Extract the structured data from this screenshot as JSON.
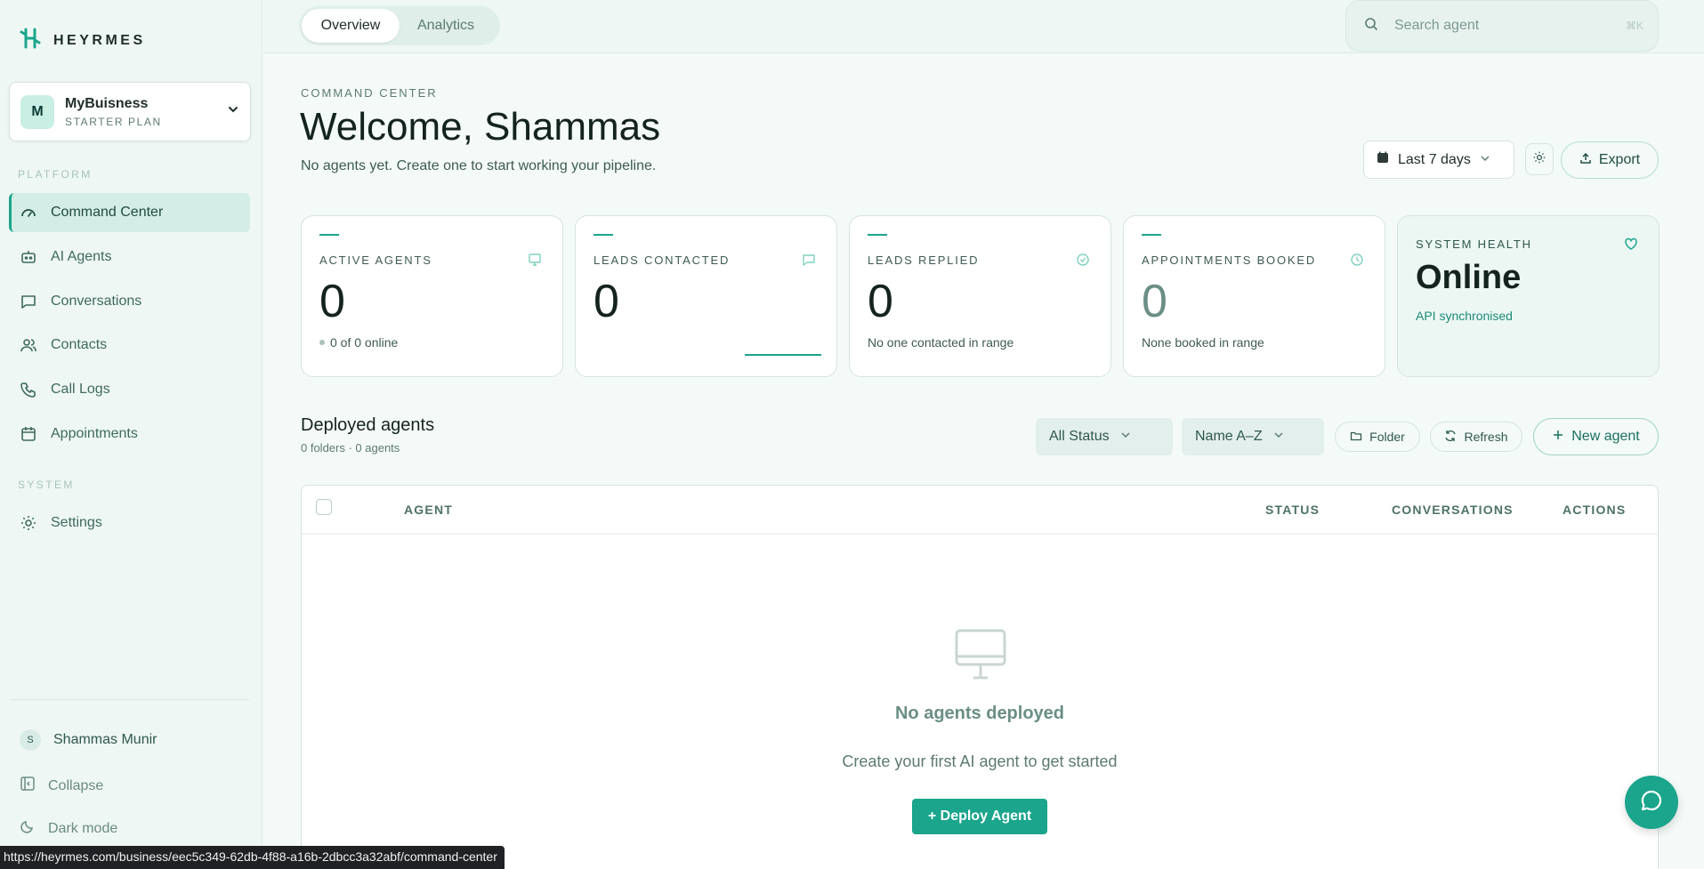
{
  "brand": {
    "name": "HEYRMES"
  },
  "business": {
    "initial": "M",
    "name": "MyBuisness",
    "plan": "STARTER PLAN"
  },
  "sidebar": {
    "platform_label": "PLATFORM",
    "system_label": "SYSTEM",
    "items": [
      {
        "label": "Command Center",
        "icon": "gauge-icon",
        "active": true
      },
      {
        "label": "AI Agents",
        "icon": "robot-icon"
      },
      {
        "label": "Conversations",
        "icon": "message-square-icon"
      },
      {
        "label": "Contacts",
        "icon": "users-icon"
      },
      {
        "label": "Call Logs",
        "icon": "phone-icon"
      },
      {
        "label": "Appointments",
        "icon": "calendar-icon"
      }
    ],
    "system_items": [
      {
        "label": "Settings",
        "icon": "gear-icon"
      }
    ],
    "user": {
      "initial": "S",
      "name": "Shammas Munir"
    },
    "collapse_label": "Collapse",
    "dark_mode_label": "Dark mode"
  },
  "topbar": {
    "tabs": [
      {
        "label": "Overview",
        "active": true
      },
      {
        "label": "Analytics"
      }
    ],
    "search": {
      "placeholder": "Search agent",
      "shortcut": "⌘K"
    }
  },
  "header": {
    "eyebrow": "COMMAND CENTER",
    "title": "Welcome, Shammas",
    "subtitle": "No agents yet. Create one to start working your pipeline.",
    "range_label": "Last 7 days",
    "export_label": "Export"
  },
  "stats": [
    {
      "label": "ACTIVE AGENTS",
      "value": "0",
      "foot": "0 of 0 online",
      "icon": "monitor-icon"
    },
    {
      "label": "LEADS CONTACTED",
      "value": "0",
      "foot": "",
      "icon": "message-icon"
    },
    {
      "label": "LEADS REPLIED",
      "value": "0",
      "foot": "No one contacted in range",
      "icon": "check-circle-icon"
    },
    {
      "label": "APPOINTMENTS BOOKED",
      "value": "0",
      "foot": "None booked in range",
      "icon": "clock-icon"
    }
  ],
  "health": {
    "label": "SYSTEM HEALTH",
    "value": "Online",
    "foot": "API synchronised",
    "icon": "heart-icon"
  },
  "deployed": {
    "title": "Deployed agents",
    "meta": "0 folders · 0 agents",
    "status_filter": "All Status",
    "sort": "Name A–Z",
    "folder_label": "Folder",
    "refresh_label": "Refresh",
    "new_label": "New agent"
  },
  "table": {
    "columns": [
      "AGENT",
      "STATUS",
      "CONVERSATIONS",
      "ACTIONS"
    ],
    "empty_title": "No agents deployed",
    "empty_subtitle": "Create your first AI agent to get started",
    "deploy_label": "+ Deploy Agent"
  },
  "statusbar": {
    "url": "https://heyrmes.com/business/eec5c349-62db-4f88-a16b-2dbcc3a32abf/command-center"
  },
  "colors": {
    "accent": "#1aa58c",
    "background": "#f4faf8",
    "sidebar": "#eef7f4"
  }
}
